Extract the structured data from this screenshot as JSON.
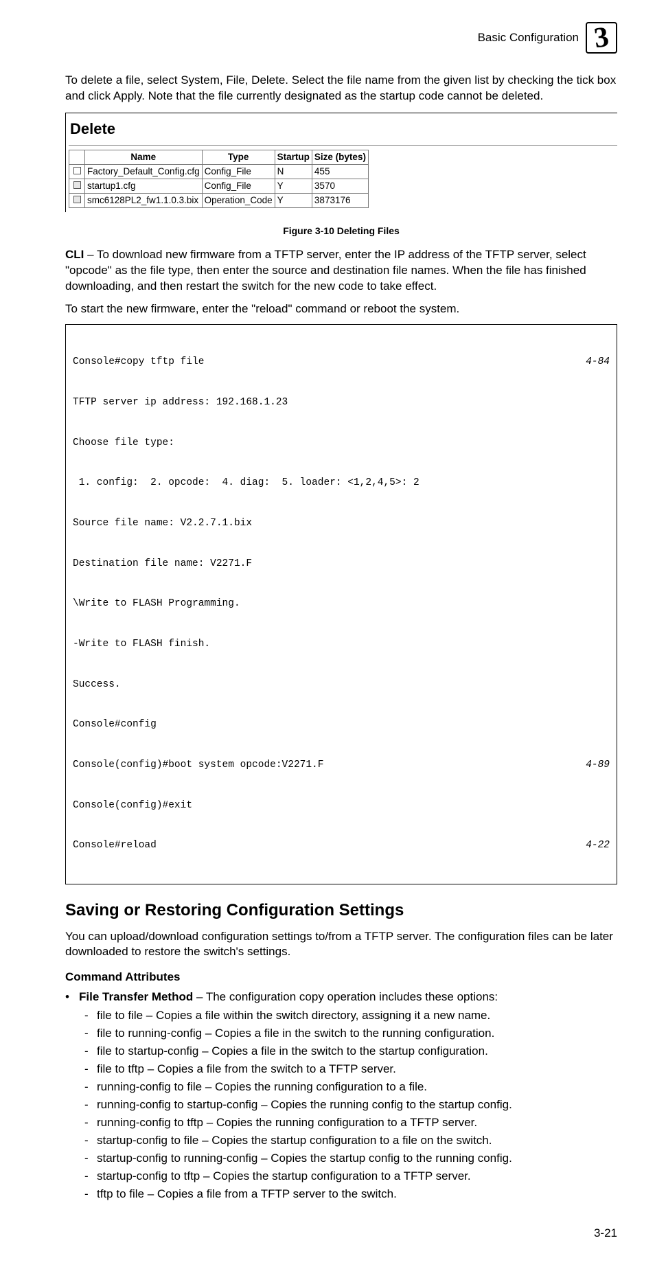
{
  "header": {
    "title": "Basic Configuration",
    "chapter_number": "3"
  },
  "intro_para": "To delete a file, select System, File, Delete. Select the file name from the given list by checking the tick box and click Apply. Note that the file currently designated as the startup code cannot be deleted.",
  "delete_panel": {
    "title": "Delete",
    "columns": {
      "blank": "",
      "name": "Name",
      "type": "Type",
      "startup": "Startup",
      "size": "Size (bytes)"
    },
    "rows": [
      {
        "cb_disabled": false,
        "name": "Factory_Default_Config.cfg",
        "type": "Config_File",
        "startup": "N",
        "size": "455"
      },
      {
        "cb_disabled": true,
        "name": "startup1.cfg",
        "type": "Config_File",
        "startup": "Y",
        "size": "3570"
      },
      {
        "cb_disabled": true,
        "name": "smc6128PL2_fw1.1.0.3.bix",
        "type": "Operation_Code",
        "startup": "Y",
        "size": "3873176"
      }
    ]
  },
  "figure_caption": "Figure 3-10  Deleting Files",
  "cli_para_lead": "CLI",
  "cli_para_rest": " – To download new firmware from a TFTP server, enter the IP address of the TFTP server, select \"opcode\" as the file type, then enter the source and destination file names. When the file has finished downloading, and then restart the switch for the new code to take effect.",
  "start_fw_para": "To start the new firmware, enter the \"reload\" command or reboot the system.",
  "cli": {
    "lines": [
      {
        "text": "Console#copy tftp file",
        "ref": "4-84"
      },
      {
        "text": "TFTP server ip address: 192.168.1.23",
        "ref": ""
      },
      {
        "text": "Choose file type:",
        "ref": ""
      },
      {
        "text": " 1. config:  2. opcode:  4. diag:  5. loader: <1,2,4,5>: 2",
        "ref": ""
      },
      {
        "text": "Source file name: V2.2.7.1.bix",
        "ref": ""
      },
      {
        "text": "Destination file name: V2271.F",
        "ref": ""
      },
      {
        "text": "\\Write to FLASH Programming.",
        "ref": ""
      },
      {
        "text": "-Write to FLASH finish.",
        "ref": ""
      },
      {
        "text": "Success.",
        "ref": ""
      },
      {
        "text": "Console#config",
        "ref": ""
      },
      {
        "text": "Console(config)#boot system opcode:V2271.F",
        "ref": "4-89"
      },
      {
        "text": "Console(config)#exit",
        "ref": ""
      },
      {
        "text": "Console#reload",
        "ref": "4-22"
      }
    ]
  },
  "section_heading": "Saving or Restoring Configuration Settings",
  "section_para": "You can upload/download configuration settings to/from a TFTP server. The configuration files can be later downloaded to restore the switch's settings.",
  "subheading": "Command Attributes",
  "lvl1_lead": "File Transfer Method",
  "lvl1_rest": " – The configuration copy operation includes these options:",
  "lvl2_items": [
    "file to file – Copies a file within the switch directory, assigning it a new name.",
    "file to running-config – Copies a file in the switch to the running configuration.",
    "file to startup-config – Copies a file in the switch to the startup configuration.",
    "file to tftp – Copies a file from the switch to a TFTP server.",
    "running-config to file – Copies the running configuration to a file.",
    "running-config to startup-config – Copies the running config to the startup config.",
    "running-config to tftp – Copies the running configuration to a TFTP server.",
    "startup-config to file – Copies the startup configuration to a file on the switch.",
    "startup-config to running-config – Copies the startup config to the running config.",
    "startup-config to tftp – Copies the startup configuration to a TFTP server.",
    "tftp to file – Copies a file from a TFTP server to the switch."
  ],
  "page_number": "3-21"
}
